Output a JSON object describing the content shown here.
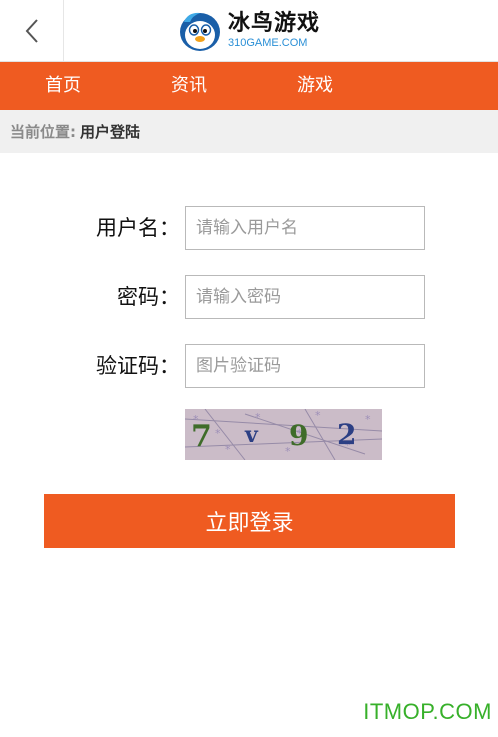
{
  "header": {
    "back_icon": "chevron-left-icon",
    "logo_text_cn": "冰鸟游戏",
    "logo_text_en": "310GAME.COM",
    "logo_icon": "penguin-mascot-icon"
  },
  "nav": {
    "items": [
      {
        "label": "首页"
      },
      {
        "label": "资讯"
      },
      {
        "label": "游戏"
      }
    ]
  },
  "breadcrumb": {
    "prefix": "当前位置:",
    "current": "用户登陆"
  },
  "form": {
    "username": {
      "label": "用户名：",
      "placeholder": "请输入用户名"
    },
    "password": {
      "label": "密码：",
      "placeholder": "请输入密码"
    },
    "captcha": {
      "label": "验证码：",
      "placeholder": "图片验证码"
    },
    "captcha_image_text": "7 v 9 2",
    "submit_label": "立即登录"
  },
  "watermark": "ITMOP.COM",
  "colors": {
    "accent": "#ef5b21",
    "nav_text": "#ffffff",
    "breadcrumb_bg": "#f0f0f0",
    "watermark": "#37b02a",
    "logo_blue": "#2a8fd6"
  }
}
